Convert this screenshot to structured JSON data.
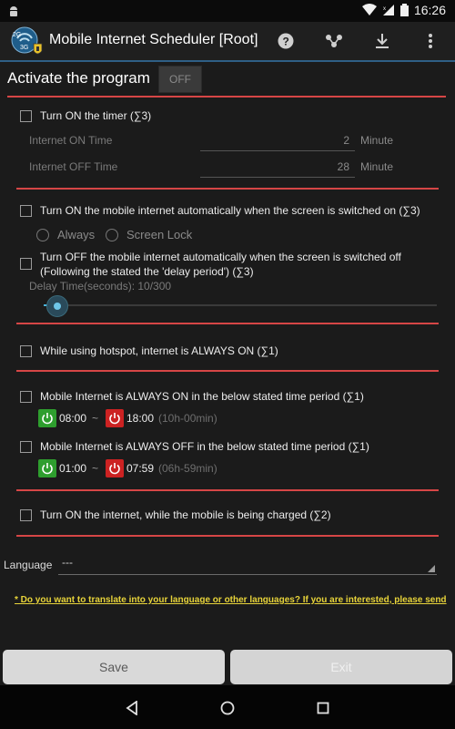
{
  "status_bar": {
    "time": "16:26"
  },
  "action_bar": {
    "title": "Mobile Internet Scheduler [Root]",
    "icon_badge_top": "2G",
    "icon_badge_bottom": "3G",
    "actions": [
      "help-icon",
      "share-icon",
      "download-icon",
      "overflow-menu-icon"
    ]
  },
  "activate": {
    "label": "Activate the program",
    "toggle": "OFF"
  },
  "timer": {
    "label": "Turn ON the timer (∑3)",
    "on_label": "Internet ON Time",
    "on_value": "2",
    "on_unit": "Minute",
    "off_label": "Internet OFF Time",
    "off_value": "28",
    "off_unit": "Minute"
  },
  "screen_on": {
    "label": "Turn ON the mobile internet automatically when the screen is switched on (∑3)",
    "option_always": "Always",
    "option_lock": "Screen Lock"
  },
  "screen_off": {
    "label": "Turn OFF the mobile internet automatically when the screen is switched off (Following the stated the 'delay period') (∑3)",
    "delay_label": "Delay Time(seconds): 10/300",
    "delay_value": 10,
    "delay_max": 300
  },
  "hotspot": {
    "label": "While using hotspot, internet is ALWAYS ON (∑1)"
  },
  "always_on": {
    "label": "Mobile Internet is ALWAYS ON in the below stated time period (∑1)",
    "start": "08:00",
    "sep": "~",
    "end": "18:00",
    "duration": "(10h-00min)"
  },
  "always_off": {
    "label": "Mobile Internet is ALWAYS OFF in the below stated time period (∑1)",
    "start": "01:00",
    "sep": "~",
    "end": "07:59",
    "duration": "(06h-59min)"
  },
  "charging": {
    "label": "Turn ON the internet, while the mobile is being charged (∑2)"
  },
  "language": {
    "label": "Language",
    "value": "---"
  },
  "translate_link": "* Do you want to translate into your language or other languages? If you are interested, please send",
  "buttons": {
    "save": "Save",
    "exit": "Exit"
  },
  "colors": {
    "accent_line": "#d64646",
    "actionbar_divider": "#2f5f86",
    "link": "#e8d43a",
    "power_on": "#2e9e2e",
    "power_off": "#cc2222"
  }
}
